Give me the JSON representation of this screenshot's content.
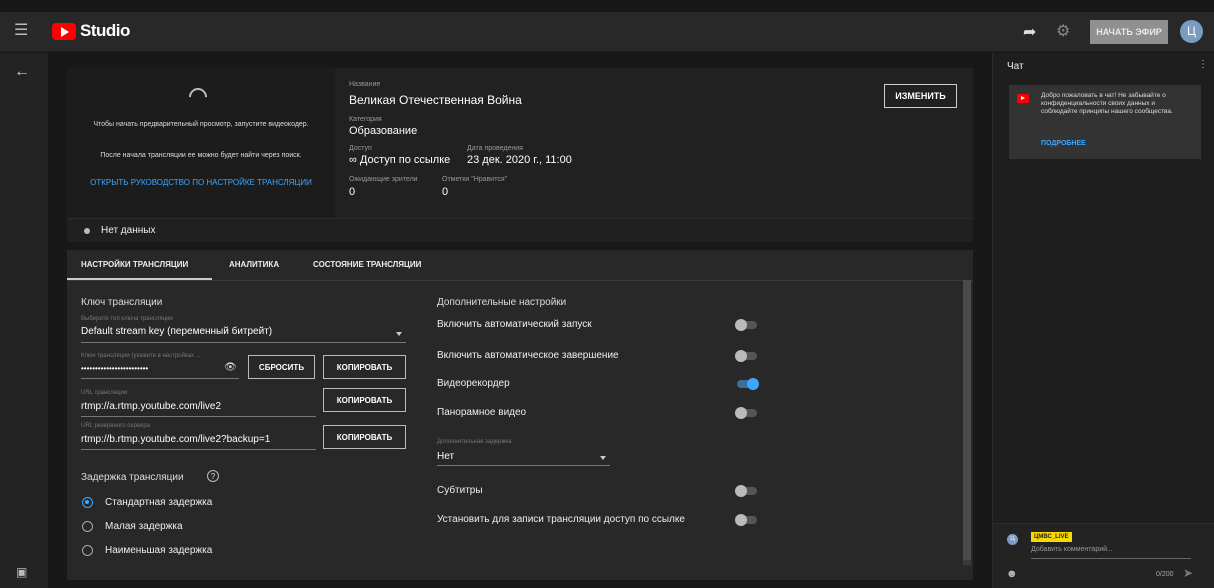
{
  "topbar": {
    "app_name": "Studio",
    "go_live_label": "НАЧАТЬ ЭФИР",
    "avatar_letter": "Ц"
  },
  "preview": {
    "text1": "Чтобы начать предварительный просмотр, запустите видеокодер.",
    "text2": "После начала трансляции ее можно будет найти через поиск.",
    "guide_link": "ОТКРЫТЬ РУКОВОДСТВО ПО НАСТРОЙКЕ ТРАНСЛЯЦИИ"
  },
  "info": {
    "title_label": "Название",
    "title_value": "Великая Отечественная Война",
    "category_label": "Категория",
    "category_value": "Образование",
    "access_label": "Доступ",
    "access_value": "∞ Доступ по ссылке",
    "date_label": "Дата проведения",
    "date_value": "23 дек. 2020 г., 11:00",
    "viewers_label": "Ожидающие зрители",
    "viewers_value": "0",
    "likes_label": "Отметки \"Нравится\"",
    "likes_value": "0",
    "edit_label": "ИЗМЕНИТЬ"
  },
  "status": {
    "text": "Нет данных"
  },
  "tabs": [
    "НАСТРОЙКИ ТРАНСЛЯЦИИ",
    "АНАЛИТИКА",
    "СОСТОЯНИЕ ТРАНСЛЯЦИИ"
  ],
  "stream_key": {
    "section_title": "Ключ трансляции",
    "type_label": "Выберите тип ключа трансляции",
    "type_value": "Default stream key (переменный битрейт)",
    "key_label": "Ключ трансляции (укажите в настройках ...",
    "key_value": "••••••••••••••••••••••••",
    "reset_label": "СБРОСИТЬ",
    "copy_label": "КОПИРОВАТЬ",
    "url_label": "URL трансляции",
    "url_value": "rtmp://a.rtmp.youtube.com/live2",
    "backup_label": "URL резервного сервера",
    "backup_value": "rtmp://b.rtmp.youtube.com/live2?backup=1"
  },
  "latency": {
    "title": "Задержка трансляции",
    "options": [
      "Стандартная задержка",
      "Малая задержка",
      "Наименьшая задержка"
    ],
    "selected": 0
  },
  "advanced": {
    "title": "Дополнительные настройки",
    "auto_start": "Включить автоматический запуск",
    "auto_stop": "Включить автоматическое завершение",
    "dvr": "Видеорекордер",
    "panoramic": "Панорамное видео",
    "delay_label": "Дополнительная задержка",
    "delay_value": "Нет",
    "subtitles": "Субтитры",
    "unlisted": "Установить для записи трансляции доступ по ссылке"
  },
  "chat": {
    "title": "Чат",
    "welcome": "Добро пожаловать в чат! Не забывайте о конфиденциальности своих данных и соблюдайте принципы нашего сообщества.",
    "more_label": "ПОДРОБНЕЕ",
    "user_name": "ЦМВС_LIVE",
    "avatar_letter": "Ц",
    "input_placeholder": "Добавить комментарий...",
    "char_count": "0/200"
  },
  "colors": {
    "accent": "#3ea6ff",
    "brand": "#ff0000",
    "user_badge": "#f7d800"
  }
}
